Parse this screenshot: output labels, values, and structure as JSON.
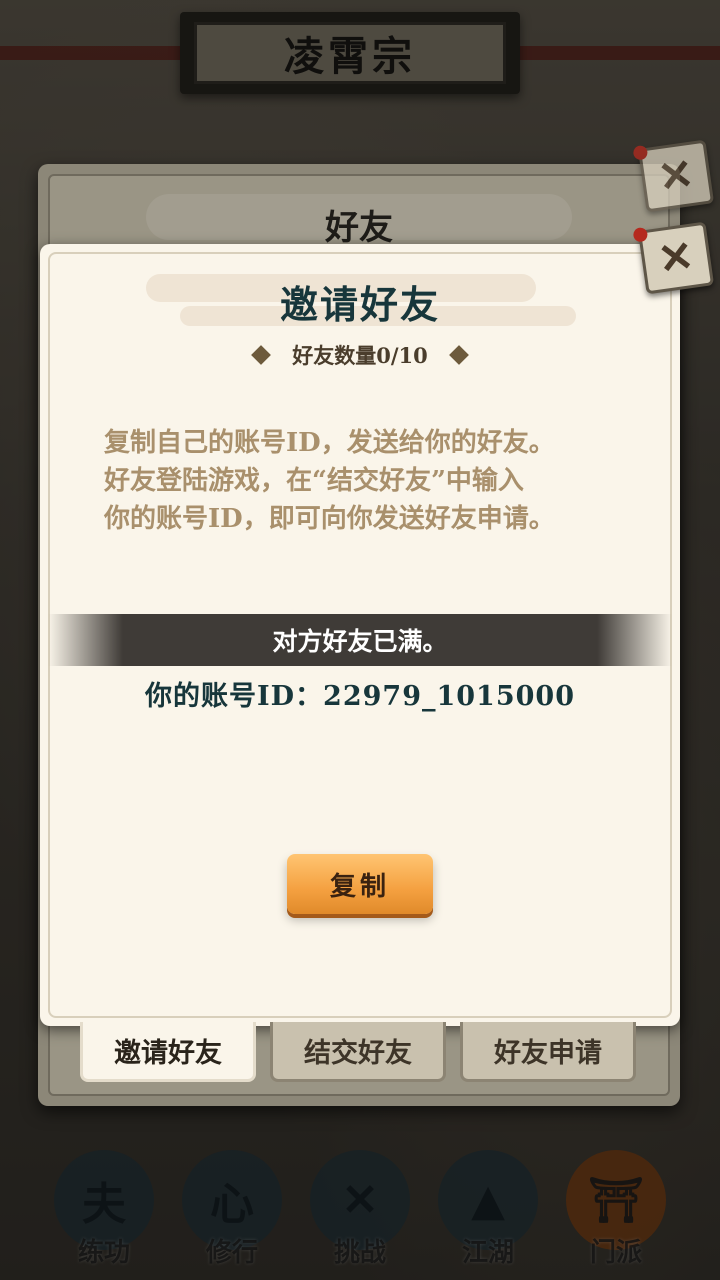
{
  "sect": {
    "title": "凌霄宗"
  },
  "friends_panel": {
    "title": "好友"
  },
  "invite_dialog": {
    "title": "邀请好友",
    "friend_count": "好友数量0/10",
    "description": [
      "复制自己的账号ID，发送给你的好友。",
      "好友登陆游戏，在“结交好友”中输入",
      "你的账号ID，即可向你发送好友申请。"
    ],
    "notice": "对方好友已满。",
    "account_id": "你的账号ID：22979_1015000",
    "copy_button": "复制"
  },
  "tabs": [
    {
      "label": "邀请好友",
      "active": true
    },
    {
      "label": "结交好友",
      "active": false
    },
    {
      "label": "好友申请",
      "active": false
    }
  ],
  "bottom_nav": [
    {
      "label": "练功",
      "icon": "martial-figure-icon"
    },
    {
      "label": "修行",
      "icon": "heart-glyph-icon"
    },
    {
      "label": "挑战",
      "icon": "crossed-swords-icon"
    },
    {
      "label": "江湖",
      "icon": "mountain-icon"
    },
    {
      "label": "门派",
      "icon": "gate-icon",
      "active": true
    }
  ],
  "colors": {
    "dialog_bg": "#faf5ea",
    "title_teal": "#17363b",
    "desc_tan": "#a9906c",
    "button_orange": "#f4a040",
    "notice_band": "#3f3b37"
  }
}
